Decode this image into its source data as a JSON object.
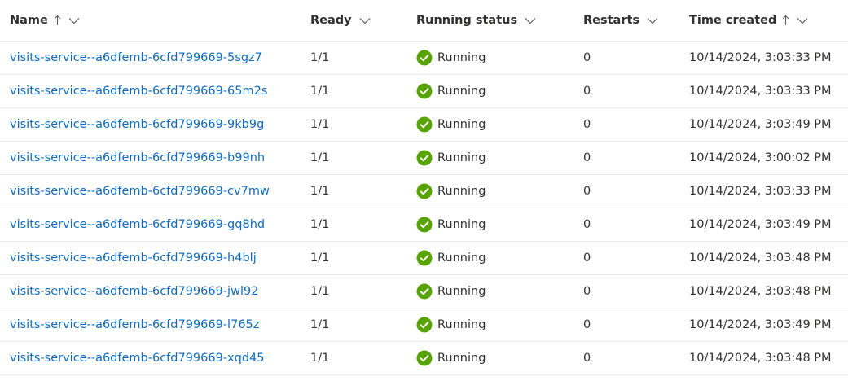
{
  "colors": {
    "link": "#0f6cbd",
    "success": "#57a300",
    "text": "#323130",
    "divider": "#edebe9"
  },
  "columns": {
    "name": {
      "label": "Name",
      "sort": "ascending"
    },
    "ready": {
      "label": "Ready"
    },
    "status": {
      "label": "Running status"
    },
    "restarts": {
      "label": "Restarts"
    },
    "time": {
      "label": "Time created",
      "sort": "ascending"
    }
  },
  "rows": [
    {
      "name": "visits-service--a6dfemb-6cfd799669-5sgz7",
      "ready": "1/1",
      "status": "Running",
      "status_icon": "success-check-icon",
      "restarts": "0",
      "time": "10/14/2024, 3:03:33 PM"
    },
    {
      "name": "visits-service--a6dfemb-6cfd799669-65m2s",
      "ready": "1/1",
      "status": "Running",
      "status_icon": "success-check-icon",
      "restarts": "0",
      "time": "10/14/2024, 3:03:33 PM"
    },
    {
      "name": "visits-service--a6dfemb-6cfd799669-9kb9g",
      "ready": "1/1",
      "status": "Running",
      "status_icon": "success-check-icon",
      "restarts": "0",
      "time": "10/14/2024, 3:03:49 PM"
    },
    {
      "name": "visits-service--a6dfemb-6cfd799669-b99nh",
      "ready": "1/1",
      "status": "Running",
      "status_icon": "success-check-icon",
      "restarts": "0",
      "time": "10/14/2024, 3:00:02 PM"
    },
    {
      "name": "visits-service--a6dfemb-6cfd799669-cv7mw",
      "ready": "1/1",
      "status": "Running",
      "status_icon": "success-check-icon",
      "restarts": "0",
      "time": "10/14/2024, 3:03:33 PM"
    },
    {
      "name": "visits-service--a6dfemb-6cfd799669-gq8hd",
      "ready": "1/1",
      "status": "Running",
      "status_icon": "success-check-icon",
      "restarts": "0",
      "time": "10/14/2024, 3:03:49 PM"
    },
    {
      "name": "visits-service--a6dfemb-6cfd799669-h4blj",
      "ready": "1/1",
      "status": "Running",
      "status_icon": "success-check-icon",
      "restarts": "0",
      "time": "10/14/2024, 3:03:48 PM"
    },
    {
      "name": "visits-service--a6dfemb-6cfd799669-jwl92",
      "ready": "1/1",
      "status": "Running",
      "status_icon": "success-check-icon",
      "restarts": "0",
      "time": "10/14/2024, 3:03:48 PM"
    },
    {
      "name": "visits-service--a6dfemb-6cfd799669-l765z",
      "ready": "1/1",
      "status": "Running",
      "status_icon": "success-check-icon",
      "restarts": "0",
      "time": "10/14/2024, 3:03:49 PM"
    },
    {
      "name": "visits-service--a6dfemb-6cfd799669-xqd45",
      "ready": "1/1",
      "status": "Running",
      "status_icon": "success-check-icon",
      "restarts": "0",
      "time": "10/14/2024, 3:03:48 PM"
    }
  ]
}
